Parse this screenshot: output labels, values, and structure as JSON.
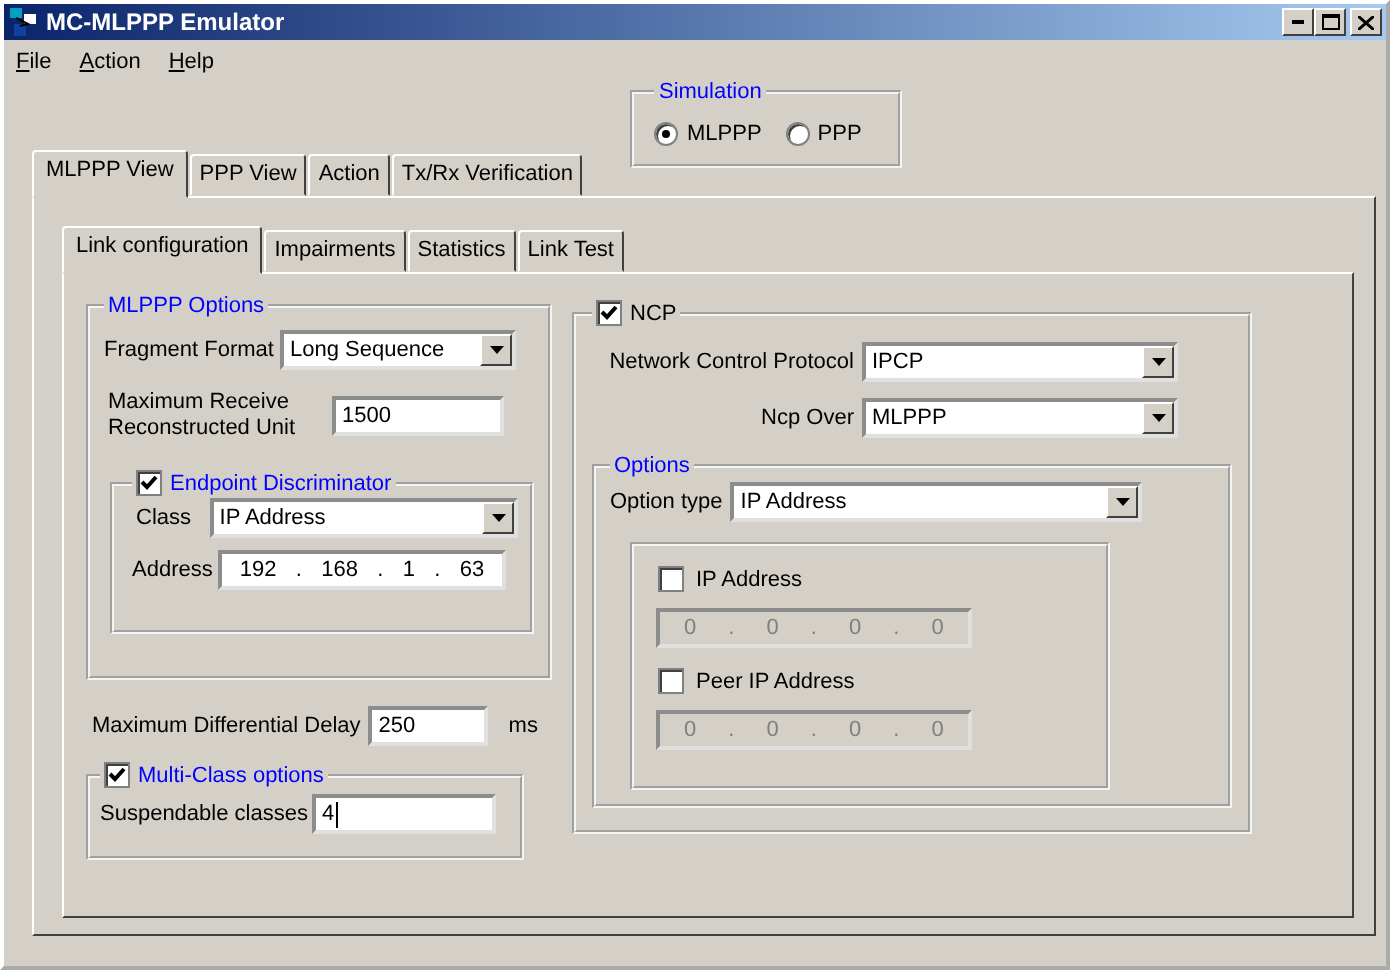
{
  "window": {
    "title": "MC-MLPPP Emulator"
  },
  "menu": [
    {
      "label": "File"
    },
    {
      "label": "Action"
    },
    {
      "label": "Help"
    }
  ],
  "simulation": {
    "title": "Simulation",
    "options": [
      {
        "label": "MLPPP",
        "selected": true
      },
      {
        "label": "PPP",
        "selected": false
      }
    ]
  },
  "tabs": [
    {
      "label": "MLPPP View",
      "selected": true
    },
    {
      "label": "PPP View",
      "selected": false
    },
    {
      "label": "Action",
      "selected": false
    },
    {
      "label": "Tx/Rx Verification",
      "selected": false
    }
  ],
  "subtabs": [
    {
      "label": "Link configuration",
      "selected": true
    },
    {
      "label": "Impairments",
      "selected": false
    },
    {
      "label": "Statistics",
      "selected": false
    },
    {
      "label": "Link Test",
      "selected": false
    }
  ],
  "mlppp_options": {
    "title": "MLPPP Options",
    "fragment_format": {
      "label": "Fragment Format",
      "value": "Long Sequence"
    },
    "mrru": {
      "label": "Maximum Receive Reconstructed Unit",
      "value": "1500"
    },
    "endpoint_discriminator": {
      "label": "Endpoint Discriminator",
      "checked": true,
      "class": {
        "label": "Class",
        "value": "IP Address"
      },
      "address": {
        "label": "Address",
        "octets": [
          "192",
          "168",
          "1",
          "63"
        ],
        "separator": ".",
        "disabled": false
      }
    }
  },
  "max_differential_delay": {
    "label": "Maximum Differential Delay",
    "value": "250",
    "unit": "ms"
  },
  "multi_class": {
    "label": "Multi-Class options",
    "checked": true,
    "suspendable_classes": {
      "label": "Suspendable classes",
      "value": "4"
    }
  },
  "ncp": {
    "label": "NCP",
    "checked": true,
    "protocol": {
      "label": "Network Control Protocol",
      "value": "IPCP"
    },
    "ncp_over": {
      "label": "Ncp Over",
      "value": "MLPPP"
    },
    "options": {
      "title": "Options",
      "option_type": {
        "label": "Option type",
        "value": "IP Address"
      },
      "ip_address": {
        "label": "IP Address",
        "checked": false,
        "octets": [
          "0",
          "0",
          "0",
          "0"
        ],
        "separator": ".",
        "disabled": true
      },
      "peer_ip_address": {
        "label": "Peer IP Address",
        "checked": false,
        "octets": [
          "0",
          "0",
          "0",
          "0"
        ],
        "separator": ".",
        "disabled": true
      }
    }
  }
}
